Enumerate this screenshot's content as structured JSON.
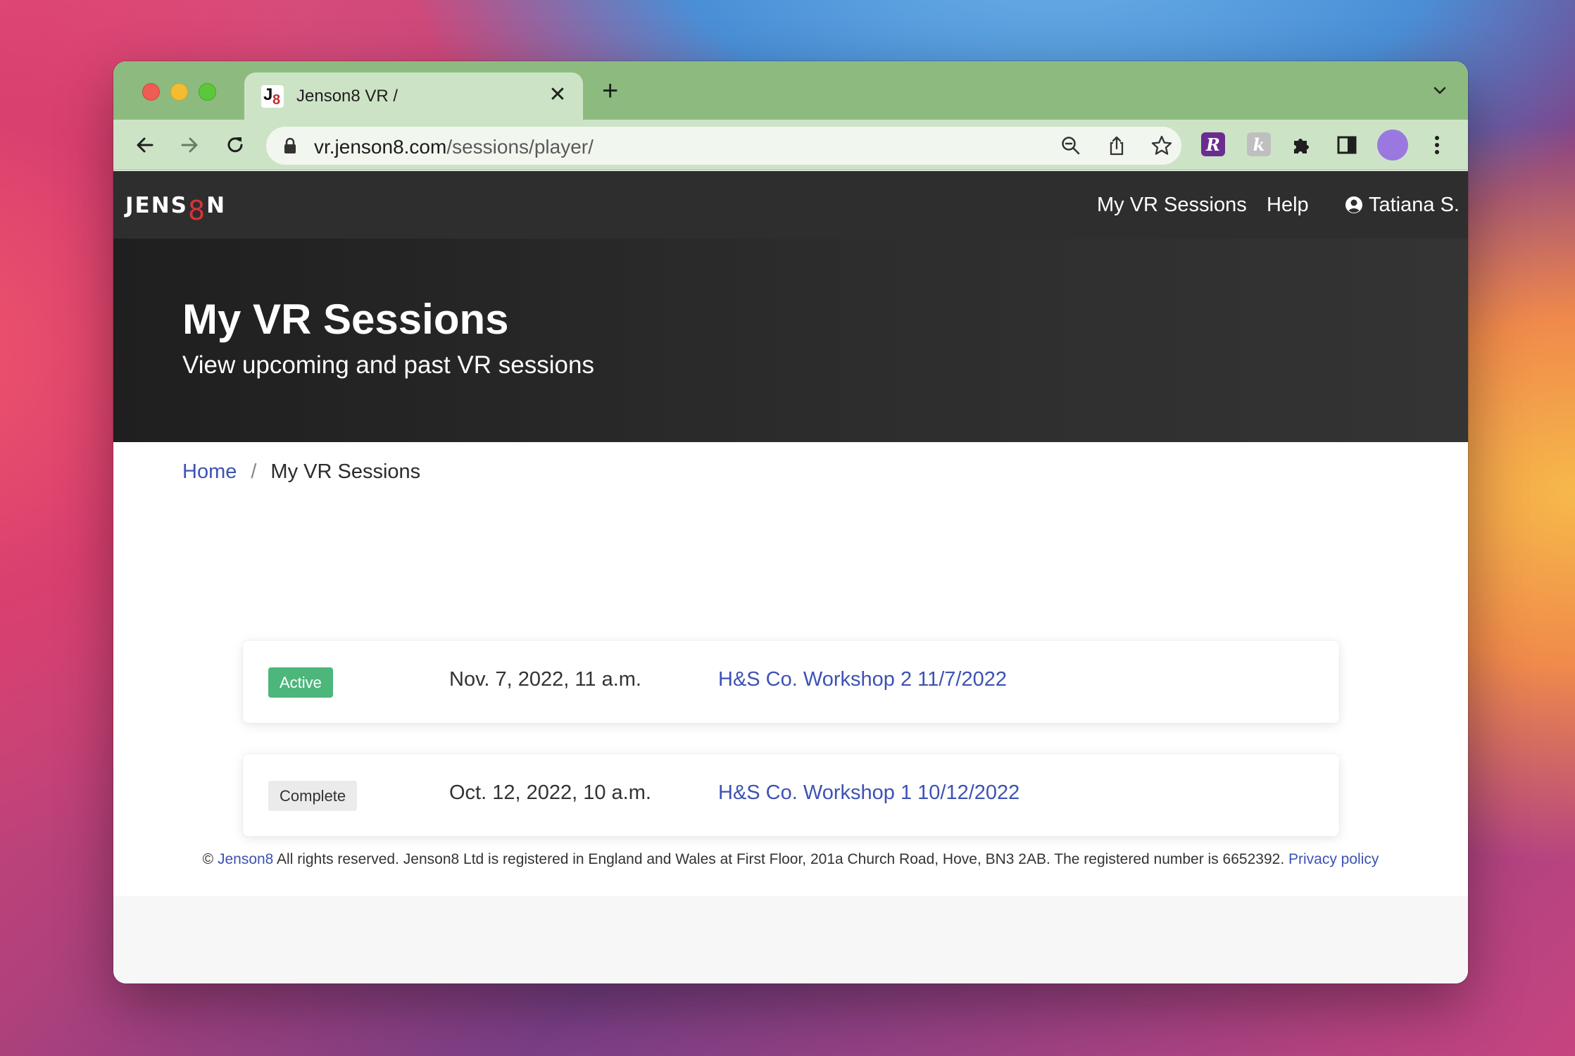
{
  "browser": {
    "tab": {
      "title": "Jenson8 VR /",
      "favicon_letters": [
        "J",
        "8"
      ]
    },
    "url": {
      "host": "vr.jenson8.com",
      "path": "/sessions/player/"
    },
    "extensions": {
      "ext1": "R",
      "ext2": "k"
    }
  },
  "site": {
    "brand": {
      "prefix": "JENS",
      "eight": "8",
      "suffix": "N"
    },
    "nav": {
      "sessions": "My VR Sessions",
      "help": "Help",
      "user": "Tatiana S."
    },
    "hero": {
      "title": "My VR Sessions",
      "subtitle": "View upcoming and past VR sessions"
    },
    "breadcrumb": {
      "home": "Home",
      "separator": "/",
      "current": "My VR Sessions"
    },
    "sessions": [
      {
        "status": "Active",
        "date": "Nov. 7, 2022, 11 a.m.",
        "name": "H&S Co. Workshop 2 11/7/2022"
      },
      {
        "status": "Complete",
        "date": "Oct. 12, 2022, 10 a.m.",
        "name": "H&S Co. Workshop 1 10/12/2022"
      }
    ],
    "footer": {
      "copyright": "©",
      "company_link": "Jenson8",
      "text": " All rights reserved. Jenson8 Ltd is registered in England and Wales at First Floor, 201a Church Road, Hove, BN3 2AB. The registered number is 6652392. ",
      "privacy_link": "Privacy policy"
    }
  },
  "colors": {
    "accent_link": "#3d52b3",
    "active_badge": "#4db67b",
    "tab_strip": "#8dbb7f",
    "brand_eight": "#d9333a"
  }
}
